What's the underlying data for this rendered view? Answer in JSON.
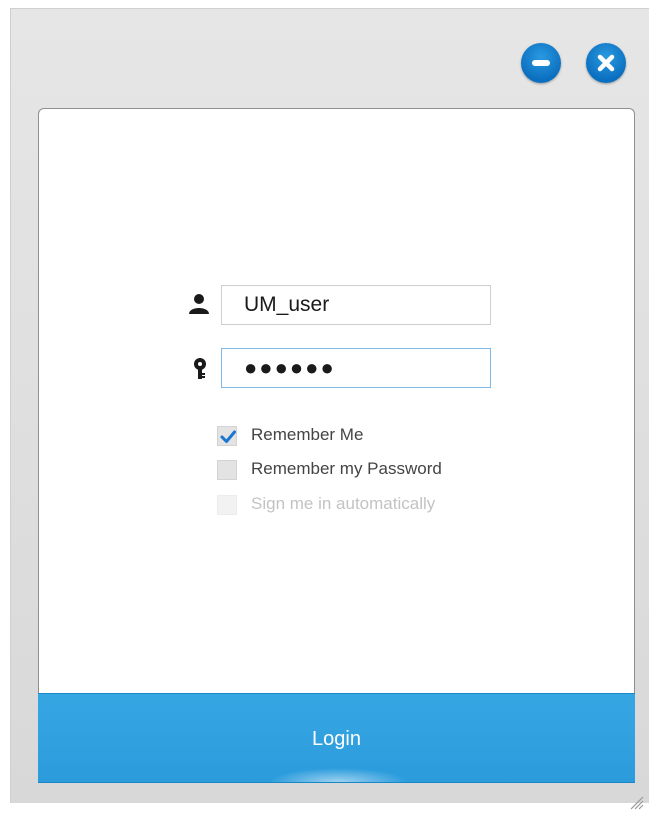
{
  "window": {
    "controls": {
      "minimize_icon": "minus-icon",
      "close_icon": "x-icon"
    }
  },
  "form": {
    "username": {
      "icon": "user-icon",
      "value": "UM_user"
    },
    "password": {
      "icon": "key-icon",
      "masked_value": "●●●●●●"
    },
    "options": [
      {
        "label": "Remember Me",
        "checked": true,
        "enabled": true
      },
      {
        "label": "Remember my Password",
        "checked": false,
        "enabled": true
      },
      {
        "label": "Sign me in automatically",
        "checked": false,
        "enabled": false
      }
    ]
  },
  "login_button": {
    "label": "Login"
  },
  "colors": {
    "accent": "#2b9bdc",
    "control_blue": "#0b6fc0",
    "check_blue": "#1976d2"
  }
}
